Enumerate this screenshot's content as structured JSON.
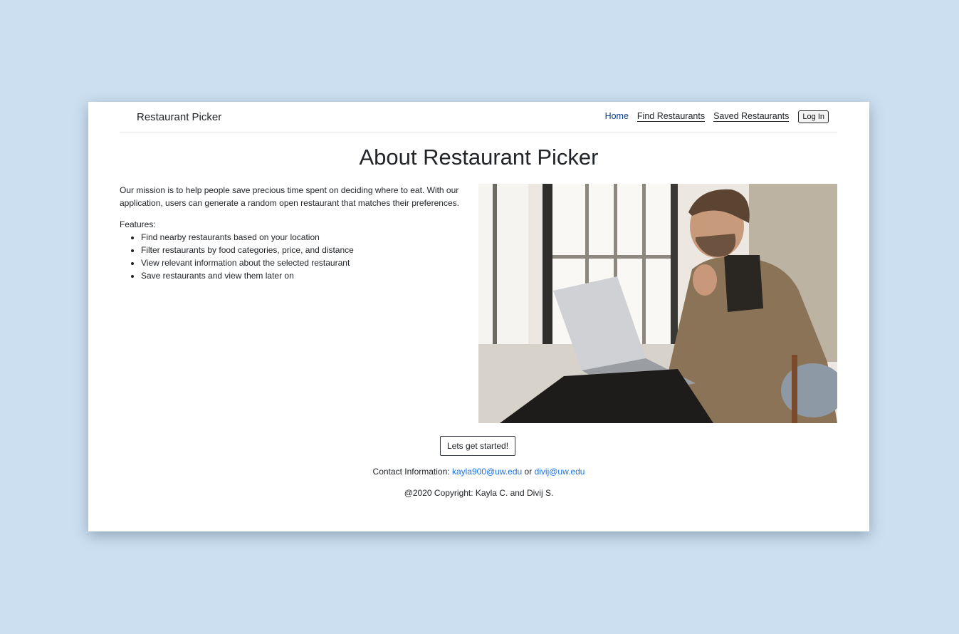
{
  "navbar": {
    "brand": "Restaurant Picker",
    "links": [
      {
        "label": "Home"
      },
      {
        "label": "Find Restaurants"
      },
      {
        "label": "Saved Restaurants"
      }
    ],
    "login_label": "Log In"
  },
  "main": {
    "title": "About Restaurant Picker",
    "mission": "Our mission is to help people save precious time spent on deciding where to eat. With our application, users can generate a random open restaurant that matches their preferences.",
    "features_label": "Features:",
    "features": [
      "Find nearby restaurants based on your location",
      "Filter restaurants by food categories, price, and distance",
      "View relevant information about the selected restaurant",
      "Save restaurants and view them later on"
    ],
    "start_button": "Lets get started!"
  },
  "footer": {
    "contact_label": "Contact Information:",
    "email_1": "kayla900@uw.edu",
    "separator": "or",
    "email_2": "divij@uw.edu",
    "copyright": "@2020 Copyright: Kayla C. and Divij S."
  },
  "colors": {
    "background": "#cbdff0",
    "active_link": "#0b3f8c",
    "email_link": "#1a73e8"
  }
}
